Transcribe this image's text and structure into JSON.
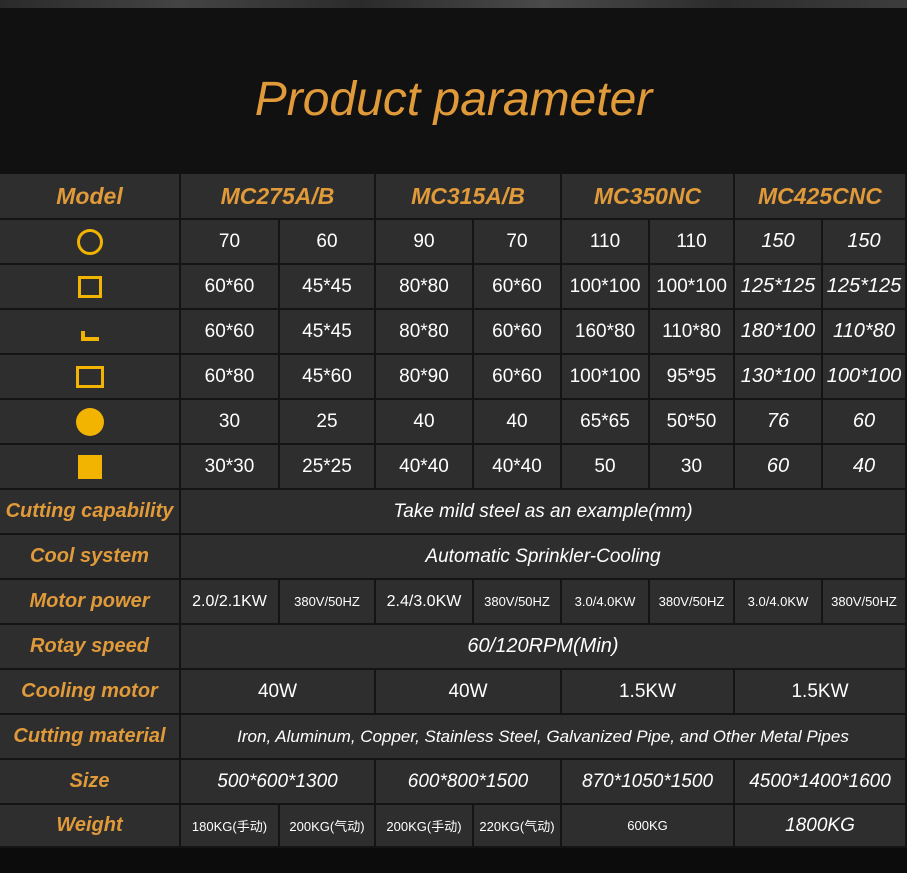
{
  "page": {
    "title": "Product parameter"
  },
  "table": {
    "header": {
      "label": "Model",
      "models": [
        "MC275A/B",
        "MC315A/B",
        "MC350NC",
        "MC425CNC"
      ]
    },
    "shape_rows": [
      {
        "icon": "round-tube-icon",
        "values": [
          "70",
          "60",
          "90",
          "70",
          "110",
          "110",
          "150",
          "150"
        ]
      },
      {
        "icon": "square-tube-icon",
        "values": [
          "60*60",
          "45*45",
          "80*80",
          "60*60",
          "100*100",
          "100*100",
          "125*125",
          "125*125"
        ]
      },
      {
        "icon": "angle-steel-icon",
        "values": [
          "60*60",
          "45*45",
          "80*80",
          "60*60",
          "160*80",
          "110*80",
          "180*100",
          "110*80"
        ]
      },
      {
        "icon": "rectangular-tube-icon",
        "values": [
          "60*80",
          "45*60",
          "80*90",
          "60*60",
          "100*100",
          "95*95",
          "130*100",
          "100*100"
        ]
      },
      {
        "icon": "round-bar-icon",
        "values": [
          "30",
          "25",
          "40",
          "40",
          "65*65",
          "50*50",
          "76",
          "60"
        ]
      },
      {
        "icon": "square-bar-icon",
        "values": [
          "30*30",
          "25*25",
          "40*40",
          "40*40",
          "50",
          "30",
          "60",
          "40"
        ]
      }
    ],
    "cutting_capability": {
      "label": "Cutting capability",
      "value": "Take mild steel as an example(mm)"
    },
    "cool_system": {
      "label": "Cool system",
      "value": "Automatic Sprinkler-Cooling"
    },
    "motor_power": {
      "label": "Motor power",
      "values": [
        "2.0/2.1KW",
        "380V/50HZ",
        "2.4/3.0KW",
        "380V/50HZ",
        "3.0/4.0KW",
        "380V/50HZ",
        "3.0/4.0KW",
        "380V/50HZ"
      ]
    },
    "rotary_speed": {
      "label": "Rotay speed",
      "value": "60/120RPM(Min)"
    },
    "cooling_motor": {
      "label": "Cooling motor",
      "values": [
        "40W",
        "40W",
        "1.5KW",
        "1.5KW"
      ]
    },
    "cutting_material": {
      "label": "Cutting material",
      "value": "Iron, Aluminum, Copper, Stainless Steel, Galvanized Pipe, and Other Metal Pipes"
    },
    "size": {
      "label": "Size",
      "values": [
        "500*600*1300",
        "600*800*1500",
        "870*1050*1500",
        "4500*1400*1600"
      ]
    },
    "weight": {
      "label": "Weight",
      "values": [
        "180KG(手动)",
        "200KG(气动)",
        "200KG(手动)",
        "220KG(气动)",
        "600KG",
        "1800KG"
      ]
    }
  }
}
